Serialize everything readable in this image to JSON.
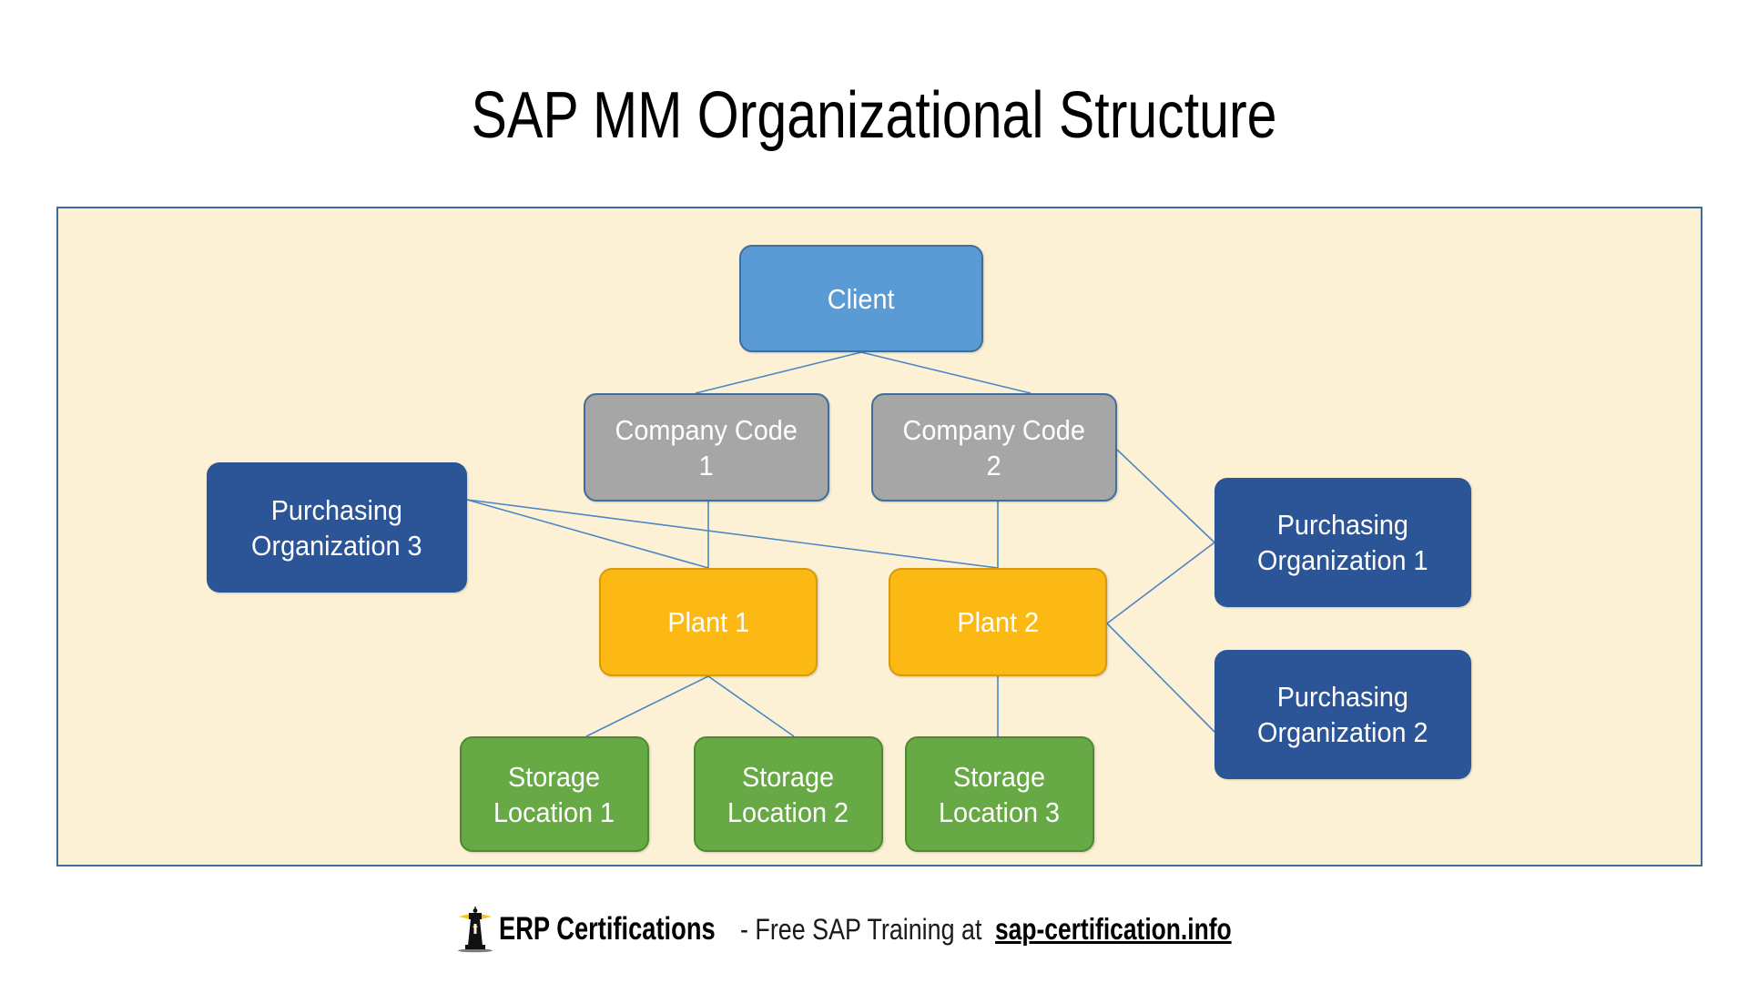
{
  "page": {
    "title": "SAP MM Organizational Structure",
    "background_color": "#ffffff"
  },
  "canvas": {
    "background_color": "#fdf1d5",
    "border_color": "#3d6f9e",
    "connector_color": "#4a87c4"
  },
  "diagram": {
    "type": "hierarchy",
    "nodes": [
      {
        "id": "client",
        "label": "Client",
        "type": "client",
        "color": "#5b9bd5",
        "border_color": "#3d6f9e",
        "text_color": "#ffffff",
        "level": 1
      },
      {
        "id": "company-code-1",
        "label": "Company Code\n1",
        "type": "company-code",
        "color": "#a6a6a6",
        "border_color": "#3d6f9e",
        "text_color": "#ffffff",
        "level": 2
      },
      {
        "id": "company-code-2",
        "label": "Company Code\n2",
        "type": "company-code",
        "color": "#a6a6a6",
        "border_color": "#3d6f9e",
        "text_color": "#ffffff",
        "level": 2
      },
      {
        "id": "plant-1",
        "label": "Plant 1",
        "type": "plant",
        "color": "#fcb913",
        "border_color": "#d79a0c",
        "text_color": "#ffffff",
        "level": 3
      },
      {
        "id": "plant-2",
        "label": "Plant 2",
        "type": "plant",
        "color": "#fcb913",
        "border_color": "#d79a0c",
        "text_color": "#ffffff",
        "level": 3
      },
      {
        "id": "storage-location-1",
        "label": "Storage\nLocation 1",
        "type": "storage-location",
        "color": "#67a945",
        "border_color": "#4e8a32",
        "text_color": "#ffffff",
        "level": 4
      },
      {
        "id": "storage-location-2",
        "label": "Storage\nLocation 2",
        "type": "storage-location",
        "color": "#67a945",
        "border_color": "#4e8a32",
        "text_color": "#ffffff",
        "level": 4
      },
      {
        "id": "storage-location-3",
        "label": "Storage\nLocation 3",
        "type": "storage-location",
        "color": "#67a945",
        "border_color": "#4e8a32",
        "text_color": "#ffffff",
        "level": 4
      },
      {
        "id": "purchasing-organization-1",
        "label": "Purchasing\nOrganization 1",
        "type": "purchasing-organization",
        "color": "#2b5597",
        "text_color": "#ffffff"
      },
      {
        "id": "purchasing-organization-2",
        "label": "Purchasing\nOrganization 2",
        "type": "purchasing-organization",
        "color": "#2b5597",
        "text_color": "#ffffff"
      },
      {
        "id": "purchasing-organization-3",
        "label": "Purchasing\nOrganization 3",
        "type": "purchasing-organization",
        "color": "#2b5597",
        "text_color": "#ffffff"
      }
    ],
    "edges": [
      {
        "from": "client",
        "to": "company-code-1"
      },
      {
        "from": "client",
        "to": "company-code-2"
      },
      {
        "from": "company-code-1",
        "to": "plant-1"
      },
      {
        "from": "company-code-2",
        "to": "plant-2"
      },
      {
        "from": "company-code-2",
        "to": "purchasing-organization-1"
      },
      {
        "from": "plant-1",
        "to": "storage-location-1"
      },
      {
        "from": "plant-1",
        "to": "storage-location-2"
      },
      {
        "from": "plant-2",
        "to": "storage-location-3"
      },
      {
        "from": "plant-2",
        "to": "purchasing-organization-1"
      },
      {
        "from": "plant-2",
        "to": "purchasing-organization-2"
      },
      {
        "from": "purchasing-organization-3",
        "to": "plant-1"
      },
      {
        "from": "purchasing-organization-3",
        "to": "plant-2"
      }
    ]
  },
  "footer": {
    "brand": "ERP Certifications",
    "tagline": "- Free SAP Training at",
    "link": "sap-certification.info",
    "logo_icon": "lighthouse-icon",
    "logo_beam_color": "#f5c518"
  }
}
